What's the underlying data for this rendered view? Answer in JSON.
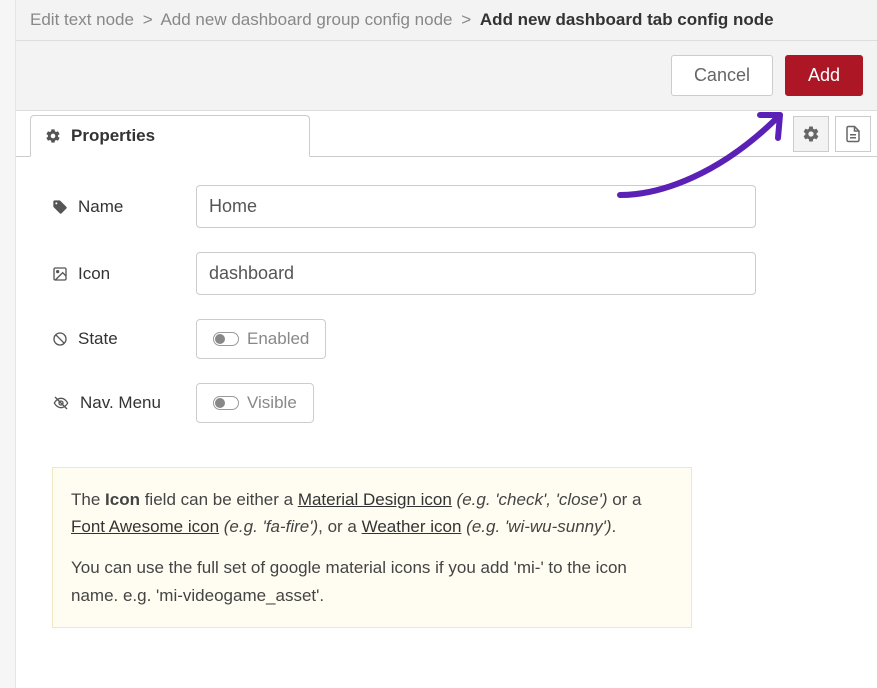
{
  "breadcrumb": {
    "seg1": "Edit text node",
    "seg2": "Add new dashboard group config node",
    "seg3": "Add new dashboard tab config node",
    "sep": ">"
  },
  "actions": {
    "cancel_label": "Cancel",
    "add_label": "Add"
  },
  "tabs": {
    "properties_label": "Properties"
  },
  "form": {
    "name": {
      "label": "Name",
      "value": "Home"
    },
    "icon": {
      "label": "Icon",
      "value": "dashboard"
    },
    "state": {
      "label": "State",
      "toggle_label": "Enabled"
    },
    "nav": {
      "label": "Nav. Menu",
      "toggle_label": "Visible"
    }
  },
  "help": {
    "p1_prefix": "The ",
    "p1_bold": "Icon",
    "p1_mid1": " field can be either a ",
    "p1_link1": "Material Design icon",
    "p1_eg1": " (e.g. 'check', 'close') ",
    "p1_or1": "or a ",
    "p1_link2": "Font Awesome icon",
    "p1_eg2": " (e.g. 'fa-fire')",
    "p1_or2": ", or a ",
    "p1_link3": "Weather icon",
    "p1_eg3": " (e.g. 'wi-wu-sunny')",
    "p1_end": ".",
    "p2": "You can use the full set of google material icons if you add 'mi-' to the icon name. e.g. 'mi-videogame_asset'."
  }
}
